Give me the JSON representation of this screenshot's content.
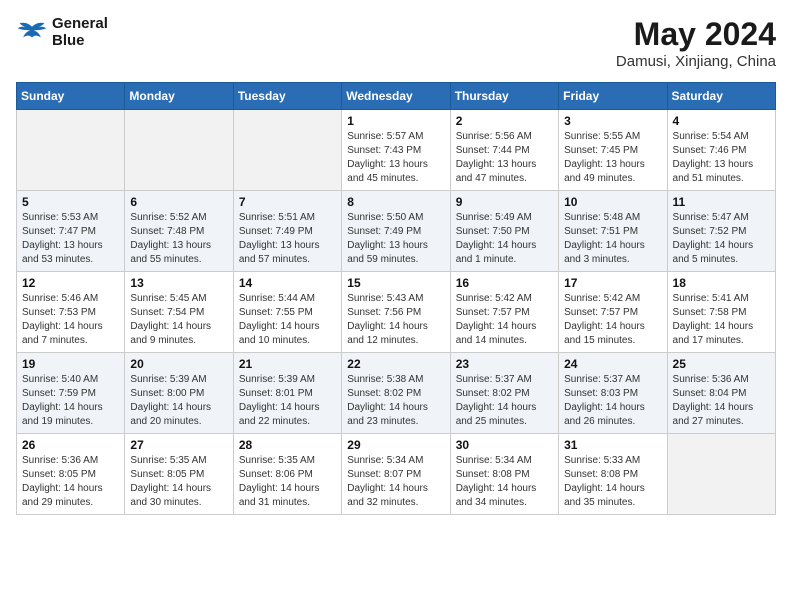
{
  "header": {
    "logo_line1": "General",
    "logo_line2": "Blue",
    "month_year": "May 2024",
    "location": "Damusi, Xinjiang, China"
  },
  "days_of_week": [
    "Sunday",
    "Monday",
    "Tuesday",
    "Wednesday",
    "Thursday",
    "Friday",
    "Saturday"
  ],
  "weeks": [
    [
      {
        "day": "",
        "info": ""
      },
      {
        "day": "",
        "info": ""
      },
      {
        "day": "",
        "info": ""
      },
      {
        "day": "1",
        "info": "Sunrise: 5:57 AM\nSunset: 7:43 PM\nDaylight: 13 hours\nand 45 minutes."
      },
      {
        "day": "2",
        "info": "Sunrise: 5:56 AM\nSunset: 7:44 PM\nDaylight: 13 hours\nand 47 minutes."
      },
      {
        "day": "3",
        "info": "Sunrise: 5:55 AM\nSunset: 7:45 PM\nDaylight: 13 hours\nand 49 minutes."
      },
      {
        "day": "4",
        "info": "Sunrise: 5:54 AM\nSunset: 7:46 PM\nDaylight: 13 hours\nand 51 minutes."
      }
    ],
    [
      {
        "day": "5",
        "info": "Sunrise: 5:53 AM\nSunset: 7:47 PM\nDaylight: 13 hours\nand 53 minutes."
      },
      {
        "day": "6",
        "info": "Sunrise: 5:52 AM\nSunset: 7:48 PM\nDaylight: 13 hours\nand 55 minutes."
      },
      {
        "day": "7",
        "info": "Sunrise: 5:51 AM\nSunset: 7:49 PM\nDaylight: 13 hours\nand 57 minutes."
      },
      {
        "day": "8",
        "info": "Sunrise: 5:50 AM\nSunset: 7:49 PM\nDaylight: 13 hours\nand 59 minutes."
      },
      {
        "day": "9",
        "info": "Sunrise: 5:49 AM\nSunset: 7:50 PM\nDaylight: 14 hours\nand 1 minute."
      },
      {
        "day": "10",
        "info": "Sunrise: 5:48 AM\nSunset: 7:51 PM\nDaylight: 14 hours\nand 3 minutes."
      },
      {
        "day": "11",
        "info": "Sunrise: 5:47 AM\nSunset: 7:52 PM\nDaylight: 14 hours\nand 5 minutes."
      }
    ],
    [
      {
        "day": "12",
        "info": "Sunrise: 5:46 AM\nSunset: 7:53 PM\nDaylight: 14 hours\nand 7 minutes."
      },
      {
        "day": "13",
        "info": "Sunrise: 5:45 AM\nSunset: 7:54 PM\nDaylight: 14 hours\nand 9 minutes."
      },
      {
        "day": "14",
        "info": "Sunrise: 5:44 AM\nSunset: 7:55 PM\nDaylight: 14 hours\nand 10 minutes."
      },
      {
        "day": "15",
        "info": "Sunrise: 5:43 AM\nSunset: 7:56 PM\nDaylight: 14 hours\nand 12 minutes."
      },
      {
        "day": "16",
        "info": "Sunrise: 5:42 AM\nSunset: 7:57 PM\nDaylight: 14 hours\nand 14 minutes."
      },
      {
        "day": "17",
        "info": "Sunrise: 5:42 AM\nSunset: 7:57 PM\nDaylight: 14 hours\nand 15 minutes."
      },
      {
        "day": "18",
        "info": "Sunrise: 5:41 AM\nSunset: 7:58 PM\nDaylight: 14 hours\nand 17 minutes."
      }
    ],
    [
      {
        "day": "19",
        "info": "Sunrise: 5:40 AM\nSunset: 7:59 PM\nDaylight: 14 hours\nand 19 minutes."
      },
      {
        "day": "20",
        "info": "Sunrise: 5:39 AM\nSunset: 8:00 PM\nDaylight: 14 hours\nand 20 minutes."
      },
      {
        "day": "21",
        "info": "Sunrise: 5:39 AM\nSunset: 8:01 PM\nDaylight: 14 hours\nand 22 minutes."
      },
      {
        "day": "22",
        "info": "Sunrise: 5:38 AM\nSunset: 8:02 PM\nDaylight: 14 hours\nand 23 minutes."
      },
      {
        "day": "23",
        "info": "Sunrise: 5:37 AM\nSunset: 8:02 PM\nDaylight: 14 hours\nand 25 minutes."
      },
      {
        "day": "24",
        "info": "Sunrise: 5:37 AM\nSunset: 8:03 PM\nDaylight: 14 hours\nand 26 minutes."
      },
      {
        "day": "25",
        "info": "Sunrise: 5:36 AM\nSunset: 8:04 PM\nDaylight: 14 hours\nand 27 minutes."
      }
    ],
    [
      {
        "day": "26",
        "info": "Sunrise: 5:36 AM\nSunset: 8:05 PM\nDaylight: 14 hours\nand 29 minutes."
      },
      {
        "day": "27",
        "info": "Sunrise: 5:35 AM\nSunset: 8:05 PM\nDaylight: 14 hours\nand 30 minutes."
      },
      {
        "day": "28",
        "info": "Sunrise: 5:35 AM\nSunset: 8:06 PM\nDaylight: 14 hours\nand 31 minutes."
      },
      {
        "day": "29",
        "info": "Sunrise: 5:34 AM\nSunset: 8:07 PM\nDaylight: 14 hours\nand 32 minutes."
      },
      {
        "day": "30",
        "info": "Sunrise: 5:34 AM\nSunset: 8:08 PM\nDaylight: 14 hours\nand 34 minutes."
      },
      {
        "day": "31",
        "info": "Sunrise: 5:33 AM\nSunset: 8:08 PM\nDaylight: 14 hours\nand 35 minutes."
      },
      {
        "day": "",
        "info": ""
      }
    ]
  ]
}
